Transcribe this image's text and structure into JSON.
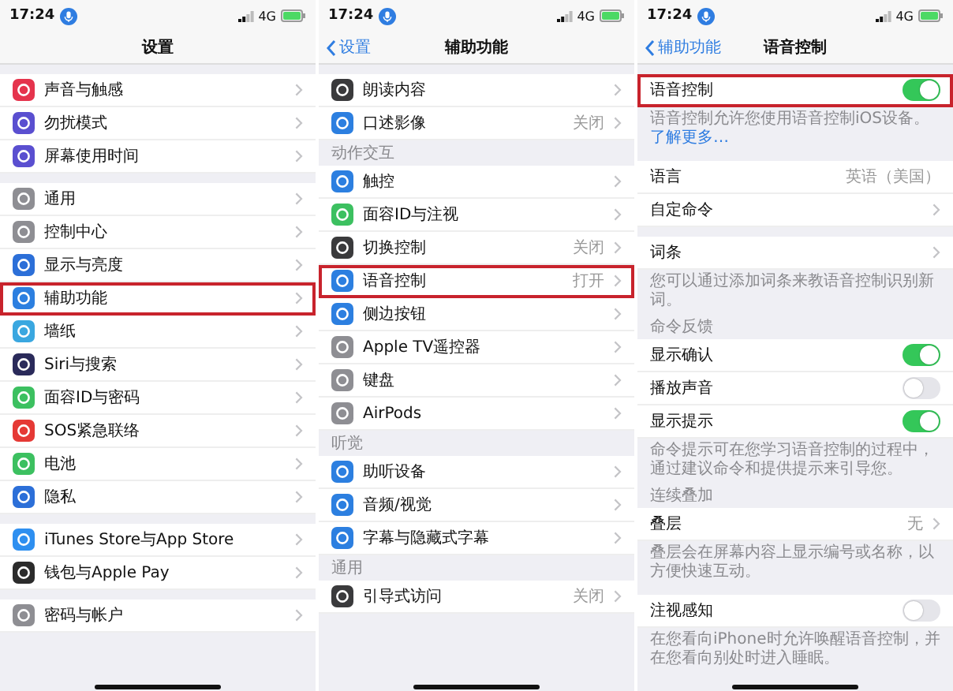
{
  "panels": [
    {
      "status": {
        "time": "17:24",
        "network": "4G"
      },
      "title": "设置",
      "sections": [
        {
          "rows": [
            {
              "label": "声音与触感",
              "kind": "link",
              "color": "#e5344d",
              "highlighted": false
            },
            {
              "label": "勿扰模式",
              "kind": "link",
              "color": "#5a4fd0",
              "highlighted": false
            },
            {
              "label": "屏幕使用时间",
              "kind": "link",
              "color": "#5a4fd0",
              "highlighted": false
            }
          ]
        },
        {
          "rows": [
            {
              "label": "通用",
              "kind": "link",
              "color": "#8e8e93",
              "highlighted": false
            },
            {
              "label": "控制中心",
              "kind": "link",
              "color": "#8e8e93",
              "highlighted": false
            },
            {
              "label": "显示与亮度",
              "kind": "link",
              "color": "#2c6fd8",
              "highlighted": false
            },
            {
              "label": "辅助功能",
              "kind": "link",
              "color": "#2c7fe0",
              "highlighted": true
            },
            {
              "label": "墙纸",
              "kind": "link",
              "color": "#3aa7e0",
              "highlighted": false
            },
            {
              "label": "Siri与搜索",
              "kind": "link",
              "color": "#2a2a5a",
              "highlighted": false
            },
            {
              "label": "面容ID与密码",
              "kind": "link",
              "color": "#3cc060",
              "highlighted": false
            },
            {
              "label": "SOS紧急联络",
              "kind": "link",
              "color": "#e53935",
              "highlighted": false
            },
            {
              "label": "电池",
              "kind": "link",
              "color": "#3cc060",
              "highlighted": false
            },
            {
              "label": "隐私",
              "kind": "link",
              "color": "#2c6fd8",
              "highlighted": false
            }
          ]
        },
        {
          "rows": [
            {
              "label": "iTunes Store与App Store",
              "kind": "link",
              "color": "#2e8ff0",
              "highlighted": false
            },
            {
              "label": "钱包与Apple Pay",
              "kind": "link",
              "color": "#2b2b2b",
              "highlighted": false
            }
          ]
        },
        {
          "rows": [
            {
              "label": "密码与帐户",
              "kind": "link",
              "color": "#8e8e93",
              "highlighted": false
            }
          ]
        }
      ]
    },
    {
      "status": {
        "time": "17:24",
        "network": "4G"
      },
      "title": "辅助功能",
      "back": "设置",
      "sections": [
        {
          "rows": [
            {
              "label": "朗读内容",
              "kind": "link",
              "color": "#3a3a3c",
              "highlighted": false
            },
            {
              "label": "口述影像",
              "value": "关闭",
              "kind": "link",
              "color": "#2c7fe0",
              "highlighted": false
            }
          ]
        },
        {
          "header": "动作交互",
          "rows": [
            {
              "label": "触控",
              "kind": "link",
              "color": "#2c7fe0",
              "highlighted": false
            },
            {
              "label": "面容ID与注视",
              "kind": "link",
              "color": "#3cc060",
              "highlighted": false
            },
            {
              "label": "切换控制",
              "value": "关闭",
              "kind": "link",
              "color": "#3a3a3c",
              "highlighted": false
            },
            {
              "label": "语音控制",
              "value": "打开",
              "kind": "link",
              "color": "#2c7fe0",
              "highlighted": true
            },
            {
              "label": "侧边按钮",
              "kind": "link",
              "color": "#2c7fe0",
              "highlighted": false
            },
            {
              "label": "Apple TV遥控器",
              "kind": "link",
              "color": "#8e8e93",
              "highlighted": false
            },
            {
              "label": "键盘",
              "kind": "link",
              "color": "#8e8e93",
              "highlighted": false
            },
            {
              "label": "AirPods",
              "kind": "link",
              "color": "#8e8e93",
              "highlighted": false
            }
          ]
        },
        {
          "header": "听觉",
          "rows": [
            {
              "label": "助听设备",
              "kind": "link",
              "color": "#2c7fe0",
              "highlighted": false
            },
            {
              "label": "音频/视觉",
              "kind": "link",
              "color": "#2c7fe0",
              "highlighted": false
            },
            {
              "label": "字幕与隐藏式字幕",
              "kind": "link",
              "color": "#2c7fe0",
              "highlighted": false
            }
          ]
        },
        {
          "header": "通用",
          "rows": [
            {
              "label": "引导式访问",
              "value": "关闭",
              "kind": "link",
              "color": "#3a3a3c",
              "highlighted": false
            }
          ]
        }
      ]
    },
    {
      "status": {
        "time": "17:24",
        "network": "4G"
      },
      "title": "语音控制",
      "back": "辅助功能",
      "sections": [
        {
          "rows": [
            {
              "label": "语音控制",
              "kind": "toggle",
              "on": true,
              "highlighted": true
            }
          ],
          "footer": "语音控制允许您使用语音控制iOS设备。",
          "footer_link": "了解更多…"
        },
        {
          "rows": [
            {
              "label": "语言",
              "value": "英语（美国）",
              "kind": "value",
              "highlighted": false
            },
            {
              "label": "自定命令",
              "kind": "link",
              "highlighted": false
            }
          ]
        },
        {
          "rows": [
            {
              "label": "词条",
              "kind": "link",
              "highlighted": false
            }
          ],
          "footer": "您可以通过添加词条来教语音控制识别新词。"
        },
        {
          "header": "命令反馈",
          "rows": [
            {
              "label": "显示确认",
              "kind": "toggle",
              "on": true,
              "highlighted": false
            },
            {
              "label": "播放声音",
              "kind": "toggle",
              "on": false,
              "highlighted": false
            },
            {
              "label": "显示提示",
              "kind": "toggle",
              "on": true,
              "highlighted": false
            }
          ],
          "footer": "命令提示可在您学习语音控制的过程中，通过建议命令和提供提示来引导您。"
        },
        {
          "header": "连续叠加",
          "rows": [
            {
              "label": "叠层",
              "value": "无",
              "kind": "link",
              "highlighted": false
            }
          ],
          "footer": "叠层会在屏幕内容上显示编号或名称，以方便快速互动。"
        },
        {
          "rows": [
            {
              "label": "注视感知",
              "kind": "toggle",
              "on": false,
              "highlighted": false
            }
          ],
          "footer": "在您看向iPhone时允许唤醒语音控制，并在您看向别处时进入睡眠。"
        }
      ]
    }
  ]
}
